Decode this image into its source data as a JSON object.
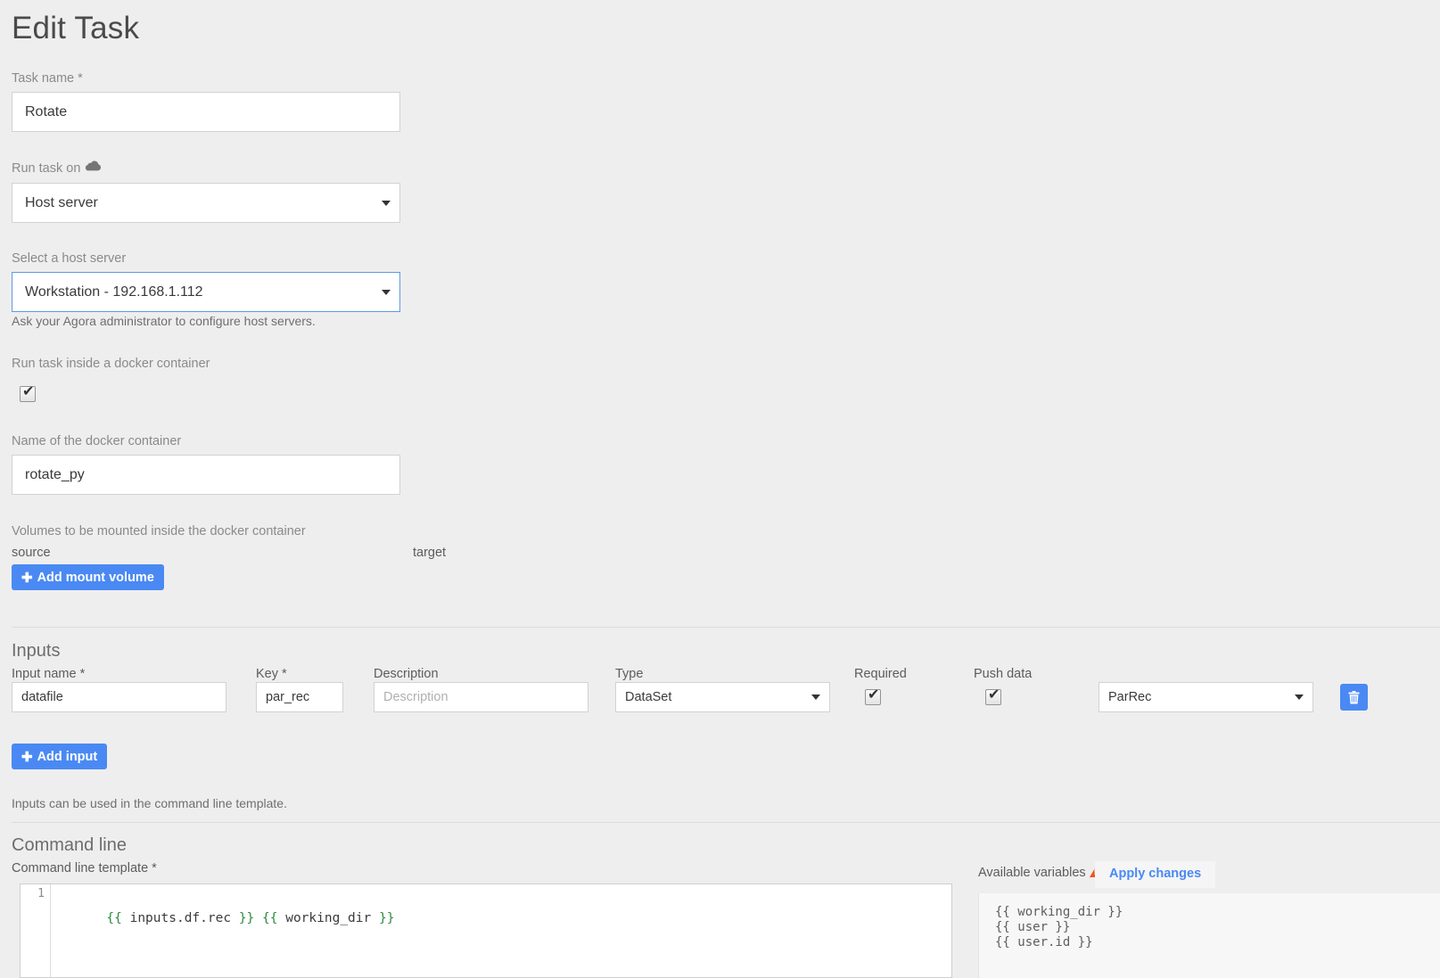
{
  "page": {
    "title": "Edit Task"
  },
  "task_name": {
    "label": "Task name *",
    "value": "Rotate"
  },
  "run_task_on": {
    "label": "Run task on",
    "icon": "cloud-icon",
    "value": "Host server"
  },
  "host_server": {
    "label": "Select a host server",
    "value": "Workstation - 192.168.1.112",
    "helper": "Ask your Agora administrator to configure host servers."
  },
  "docker": {
    "run_inside_label": "Run task inside a docker container",
    "checked": true,
    "name_label": "Name of the docker container",
    "name_value": "rotate_py",
    "volumes_label": "Volumes to be mounted inside the docker container",
    "col_source": "source",
    "col_target": "target",
    "add_volume_button": "Add mount volume"
  },
  "inputs": {
    "section_title": "Inputs",
    "columns": {
      "name": "Input name *",
      "key": "Key *",
      "description": "Description",
      "type": "Type",
      "required": "Required",
      "push_data": "Push data"
    },
    "rows": [
      {
        "name": "datafile",
        "key": "par_rec",
        "description_placeholder": "Description",
        "description_value": "",
        "type": "DataSet",
        "required": true,
        "push_data": true,
        "format": "ParRec",
        "delete_icon": "trash-icon"
      }
    ],
    "add_input_button": "Add input",
    "hint": "Inputs can be used in the command line template."
  },
  "command_line": {
    "section_title": "Command line",
    "template_label": "Command line template *",
    "line_number": "1",
    "template_tokens": [
      {
        "t": "{{",
        "k": "brace"
      },
      {
        "t": " inputs.df.rec ",
        "k": "text"
      },
      {
        "t": "}}",
        "k": "brace"
      },
      {
        "t": " ",
        "k": "text"
      },
      {
        "t": "{{",
        "k": "brace"
      },
      {
        "t": " working_dir ",
        "k": "text"
      },
      {
        "t": "}}",
        "k": "brace"
      }
    ],
    "template_text": "{{ inputs.df.rec }} {{ working_dir }}"
  },
  "variables_panel": {
    "title": "Available variables",
    "warning_icon": "warning-triangle-icon",
    "apply_button": "Apply changes",
    "variables": [
      "{{ working_dir }}",
      "{{ user }}",
      "{{ user.id }}"
    ]
  },
  "colors": {
    "accent_blue": "#4a89f3",
    "page_bg": "#eeeeee",
    "warning_orange": "#f4511e",
    "brace_green": "#2f8a3f"
  }
}
